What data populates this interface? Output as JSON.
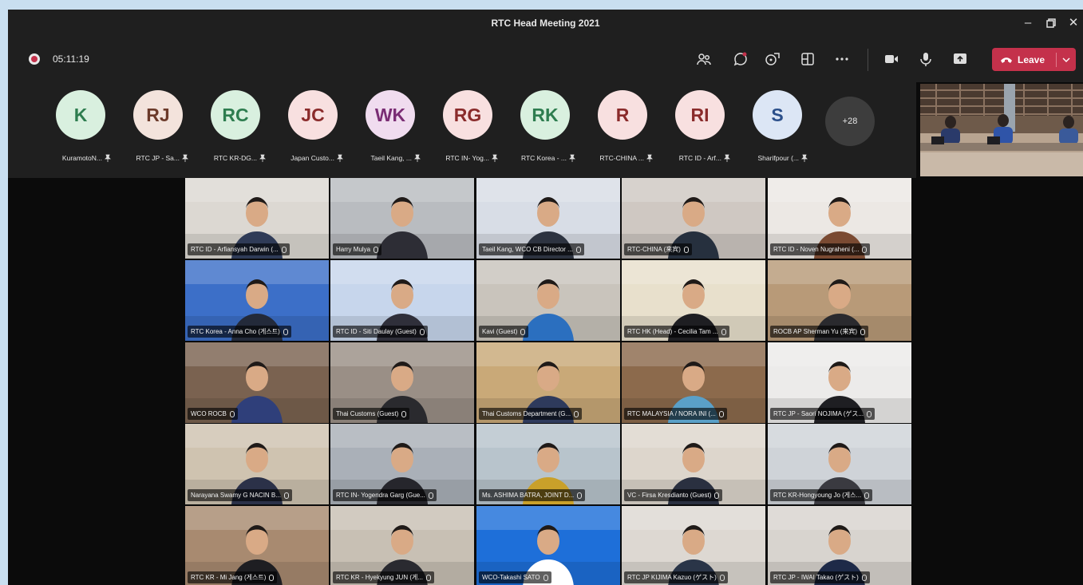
{
  "window": {
    "title": "RTC Head Meeting 2021",
    "controls": [
      "minimize-icon",
      "restore-icon",
      "close-icon"
    ]
  },
  "toolbar": {
    "timer": "05:11:19",
    "buttons": [
      "people-icon",
      "chat-icon",
      "reactions-icon",
      "share-tray-icon",
      "more-icon",
      "camera-icon",
      "mic-icon",
      "share-screen-icon"
    ],
    "leave_label": "Leave"
  },
  "colors": {
    "leave": "#c4314b",
    "titlebar": "#1f1f1f",
    "stage": "#0b0b0b",
    "frame": "#c9dff0"
  },
  "participants": [
    {
      "initials": "K",
      "name": "KuramotoN...",
      "bg": "#d9f0df",
      "fg": "#2e7d4f"
    },
    {
      "initials": "RJ",
      "name": "RTC JP - Sa...",
      "bg": "#f3e3dc",
      "fg": "#6b3a2a"
    },
    {
      "initials": "RC",
      "name": "RTC KR-DG...",
      "bg": "#d9f0df",
      "fg": "#2e7d4f"
    },
    {
      "initials": "JC",
      "name": "Japan Custo...",
      "bg": "#f8e0e0",
      "fg": "#8a2b2b"
    },
    {
      "initials": "WK",
      "name": "Taeil Kang, ...",
      "bg": "#f0dcef",
      "fg": "#7a2d74"
    },
    {
      "initials": "RG",
      "name": "RTC IN- Yog...",
      "bg": "#f8e0e0",
      "fg": "#8a2b2b"
    },
    {
      "initials": "RK",
      "name": "RTC Korea - ...",
      "bg": "#d9f0df",
      "fg": "#2e7d4f"
    },
    {
      "initials": "R",
      "name": "RTC-CHINA ...",
      "bg": "#f8e0e0",
      "fg": "#8a2b2b"
    },
    {
      "initials": "RI",
      "name": "RTC ID - Arf...",
      "bg": "#f8e0e0",
      "fg": "#8a2b2b"
    },
    {
      "initials": "S",
      "name": "Sharifpour (...",
      "bg": "#dce6f5",
      "fg": "#2b4f8a"
    }
  ],
  "overflow_count": "+28",
  "videos": [
    "RTC ID - Arfiansyah Darwin (...",
    "Harry Mulya",
    "Taeil Kang, WCO CB Director ...",
    "RTC-CHINA (来宾)",
    "RTC ID - Noven Nugraheni (...",
    "RTC Korea - Anna Cho (게스트)",
    "RTC ID - Siti Daulay (Guest)",
    "Kavi (Guest)",
    "RTC HK (Head) - Cecilia Tam ...",
    "ROCB AP Sherman Yu (来宾)",
    "WCO ROCB",
    "Thai Customs (Guest)",
    "Thai Customs Department (G...",
    "RTC MALAYSIA / NORA INI (...",
    "RTC JP - Saori NOJIMA (ゲス...",
    "Narayana Swamy G NACIN B...",
    "RTC IN- Yogendra Garg (Gue...",
    "Ms. ASHIMA BATRA, JOINT D...",
    "VC - Firsa Kresdianto (Guest)",
    "RTC KR-Hongyoung Jo (게스...",
    "RTC KR - Mi Jang (게스트)",
    "RTC KR - Hyekyung JUN (게...",
    "WCO-Takashi SATO",
    "RTC JP KIJIMA Kazuo (ゲスト)",
    "RTC JP - IWAI Takao (ゲスト)"
  ],
  "video_backgrounds": [
    "#dcd8d2",
    "#b9bcc0",
    "#d8dde6",
    "#cfc8c2",
    "#ece8e4",
    "#3c6fc8",
    "#c7d6ec",
    "#c9c4bc",
    "#e8e0cc",
    "#b89a78",
    "#7a6250",
    "#9a8f86",
    "#c9a978",
    "#8c6a4c",
    "#ecebea",
    "#cfc3b0",
    "#aab0b8",
    "#b8c4cc",
    "#ddd6cc",
    "#cfd3d8",
    "#a88a70",
    "#c8c0b4",
    "#1e6fd9",
    "#ddd8d2",
    "#d8d4cf"
  ],
  "shirt_colors": [
    "#2f3b57",
    "#2d2d35",
    "#2d3340",
    "#26303e",
    "#7a4a32",
    "#232a3a",
    "#2f2f3a",
    "#2b6fbf",
    "#1e1e22",
    "#2a2a2e",
    "#2f3f7a",
    "#2a2a2e",
    "#2e3a5c",
    "#5aa0c8",
    "#1e1e22",
    "#2b3148",
    "#26262c",
    "#c9a02a",
    "#2a3040",
    "#3a3a40",
    "#1e1e22",
    "#2a2a30",
    "#ffffff",
    "#2a3548",
    "#1e2a48"
  ]
}
